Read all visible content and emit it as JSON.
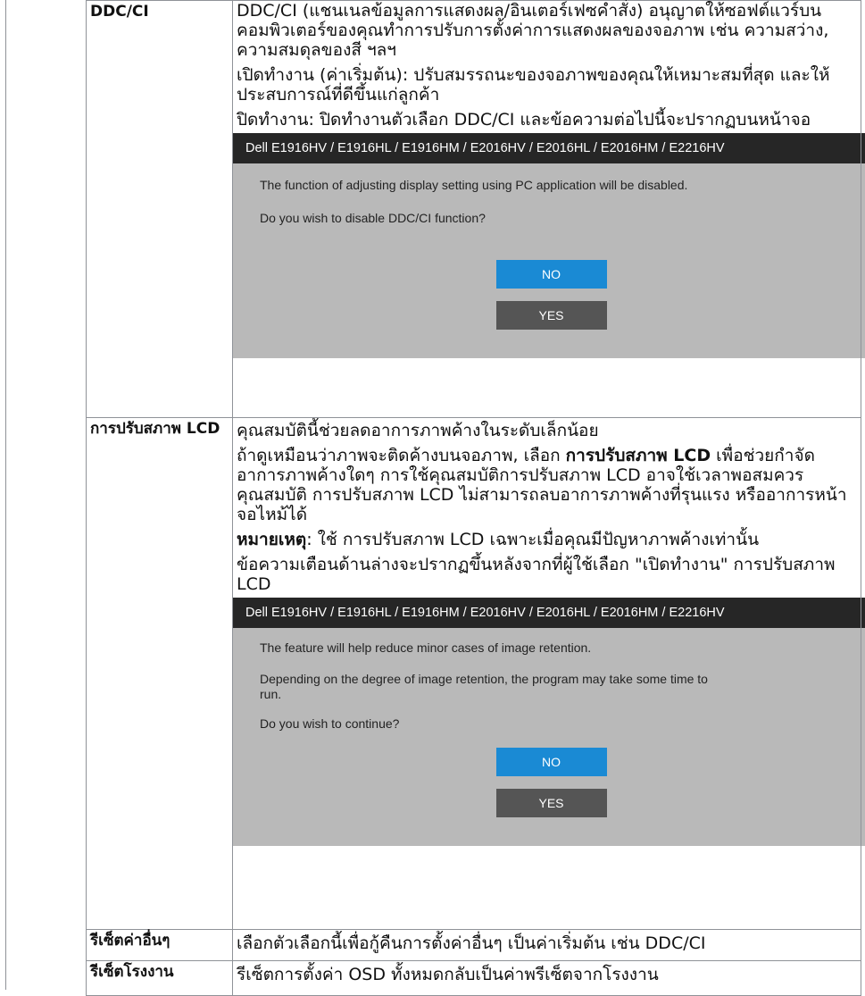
{
  "rows": [
    {
      "label": "DDC/CI",
      "paragraphs": [
        "DDC/CI (แชนเนลข้อมูลการแสดงผล/อินเตอร์เฟซคำสั่ง) อนุญาตให้ซอฟต์แวร์บนคอมพิวเตอร์ของคุณทำการปรับการตั้งค่าการแสดงผลของจอภาพ เช่น ความสว่าง, ความสมดุลของสี ฯลฯ",
        "เปิดทำงาน (ค่าเริ่มต้น): ปรับสมรรถนะของจอภาพของคุณให้เหมาะสมที่สุด และให้ประสบการณ์ที่ดีขึ้นแก่ลูกค้า",
        "ปิดทำงาน: ปิดทำงานตัวเลือก DDC/CI และข้อความต่อไปนี้จะปรากฏบนหน้าจอ"
      ],
      "dialog": {
        "title": "Dell E1916HV / E1916HL / E1916HM / E2016HV / E2016HL / E2016HM / E2216HV",
        "lines": [
          "The function of adjusting display setting using PC application will be disabled.",
          "Do you wish to disable DDC/CI function?"
        ],
        "no_label": "NO",
        "yes_label": "YES"
      }
    },
    {
      "label": "การปรับสภาพ LCD",
      "p1": "คุณสมบัตินี้ช่วยลดอาการภาพค้างในระดับเล็กน้อย",
      "p2_pre": "ถ้าดูเหมือนว่าภาพจะติดค้างบนจอภาพ, เลือก ",
      "p2_bold": "การปรับสภาพ LCD",
      "p2_post": " เพื่อช่วยกำจัดอาการภาพค้างใดๆ การใช้คุณสมบัติการปรับสภาพ LCD อาจใช้เวลาพอสมควร คุณสมบัติ การปรับสภาพ LCD ไม่สามารถลบอาการภาพค้างที่รุนแรง หรืออาการหน้าจอไหม้ได้",
      "p3_bold": "หมายเหตุ",
      "p3_post": ": ใช้ การปรับสภาพ LCD เฉพาะเมื่อคุณมีปัญหาภาพค้างเท่านั้น",
      "p4": "ข้อความเตือนด้านล่างจะปรากฏขึ้นหลังจากที่ผู้ใช้เลือก \"เปิดทำงาน\" การปรับสภาพ LCD",
      "dialog": {
        "title": "Dell E1916HV / E1916HL / E1916HM / E2016HV / E2016HL / E2016HM / E2216HV",
        "lines": [
          "The feature will help reduce minor cases of image retention.",
          "Depending on the degree of image retention, the program may take some time to run.",
          "Do you wish to continue?"
        ],
        "no_label": "NO",
        "yes_label": "YES"
      }
    },
    {
      "label": "รีเซ็ตค่าอื่นๆ",
      "text": "เลือกตัวเลือกนี้เพื่อกู้คืนการตั้งค่าอื่นๆ เป็นค่าเริ่มต้น เช่น DDC/CI"
    },
    {
      "label": "รีเซ็ตโรงงาน",
      "text": "รีเซ็ตการตั้งค่า OSD ทั้งหมดกลับเป็นค่าพรีเซ็ตจากโรงงาน"
    }
  ]
}
